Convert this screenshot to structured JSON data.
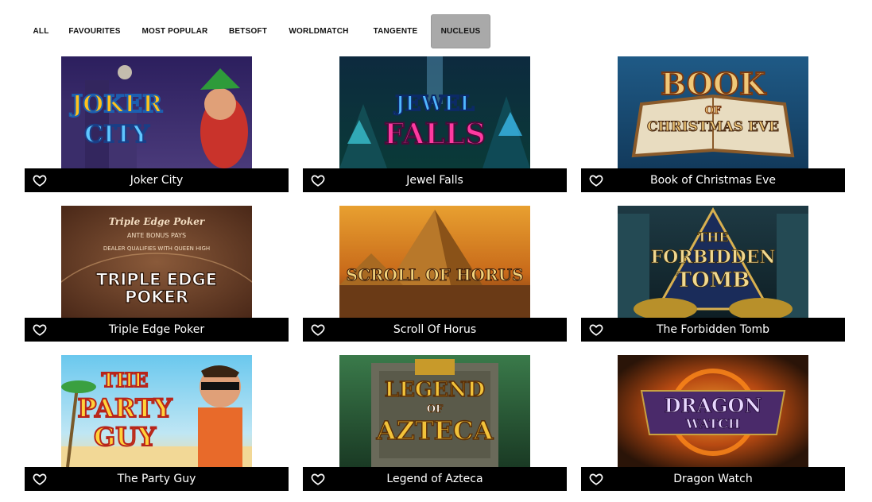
{
  "tabs": [
    {
      "label": "ALL",
      "active": false
    },
    {
      "label": "FAVOURITES",
      "active": false
    },
    {
      "label": "MOST POPULAR",
      "active": false
    },
    {
      "label": "BETSOFT",
      "active": false
    },
    {
      "label": "WORLDMATCH",
      "active": false
    },
    {
      "label": "TANGENTE",
      "active": false
    },
    {
      "label": "NUCLEUS",
      "active": true
    }
  ],
  "games": [
    {
      "title": "Joker City",
      "art_lines": [
        "JOKER",
        "CITY"
      ],
      "icon": "heart-icon"
    },
    {
      "title": "Jewel Falls",
      "art_lines": [
        "JEWEL",
        "FALLS"
      ],
      "icon": "heart-icon"
    },
    {
      "title": "Book of Christmas Eve",
      "art_lines": [
        "BOOK",
        "OF",
        "CHRISTMAS EVE"
      ],
      "icon": "heart-icon"
    },
    {
      "title": "Triple Edge Poker",
      "art_lines": [
        "Triple Edge Poker",
        "ANTE BONUS PAYS",
        "DEALER QUALIFIES WITH QUEEN HIGH",
        "TRIPLE EDGE",
        "POKER"
      ],
      "icon": "heart-icon"
    },
    {
      "title": "Scroll Of Horus",
      "art_lines": [
        "SCROLL OF HORUS"
      ],
      "icon": "heart-icon"
    },
    {
      "title": "The Forbidden Tomb",
      "art_lines": [
        "THE",
        "FORBIDDEN",
        "TOMB"
      ],
      "icon": "heart-icon"
    },
    {
      "title": "The Party Guy",
      "art_lines": [
        "THE",
        "PARTY",
        "GUY"
      ],
      "icon": "heart-icon"
    },
    {
      "title": "Legend of Azteca",
      "art_lines": [
        "LEGEND",
        "OF",
        "AZTECA"
      ],
      "icon": "heart-icon"
    },
    {
      "title": "Dragon Watch",
      "art_lines": [
        "DRAGON",
        "WATCH"
      ],
      "icon": "heart-icon"
    }
  ],
  "colors": {
    "tab_active_bg": "#a9a9a9",
    "title_bar_bg": "#000000",
    "title_text": "#ffffff"
  }
}
